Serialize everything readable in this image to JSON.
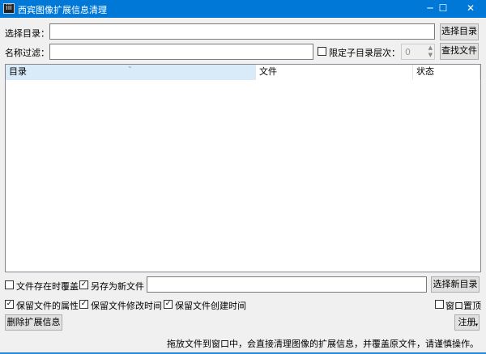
{
  "window": {
    "title": "西宾图像扩展信息清理",
    "icon": "app-icon",
    "controls": {
      "minimize": "─",
      "maximize": "☐",
      "close": "✕"
    }
  },
  "select_dir": {
    "label": "选择目录：",
    "value": "",
    "button": "选择目录"
  },
  "filter": {
    "label": "名称过滤：",
    "value": "",
    "limit_depth_label": "限定子目录层次：",
    "limit_depth_checked": false,
    "depth_value": "0",
    "button": "查找文件"
  },
  "table": {
    "columns": [
      "目录",
      "文件",
      "状态"
    ],
    "rows": []
  },
  "options": {
    "overwrite_label": "文件存在时覆盖",
    "overwrite_checked": false,
    "save_as_new_label": "另存为新文件",
    "save_as_new_checked": true,
    "new_dir_value": "",
    "new_dir_button": "选择新目录",
    "keep_attr_label": "保留文件的属性",
    "keep_attr_checked": true,
    "keep_mtime_label": "保留文件修改时间",
    "keep_mtime_checked": true,
    "keep_ctime_label": "保留文件创建时间",
    "keep_ctime_checked": true,
    "topmost_label": "窗口置顶",
    "topmost_checked": false
  },
  "actions": {
    "delete_button": "删除扩展信息",
    "register_button": "注册"
  },
  "status": "拖放文件到窗口中，会直接清理图像的扩展信息，并覆盖原文件，请谨慎操作。"
}
